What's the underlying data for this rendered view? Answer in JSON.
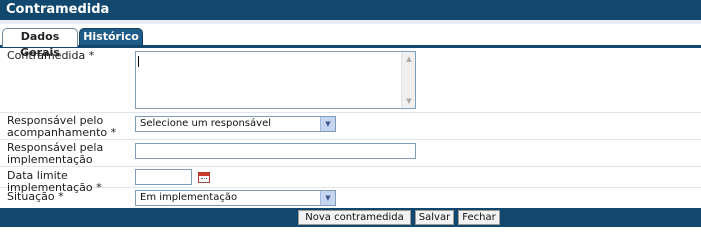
{
  "window": {
    "title": "Contramedida"
  },
  "tabs": [
    {
      "label": "Dados Gerais",
      "active": true
    },
    {
      "label": "Histórico",
      "active": false
    }
  ],
  "form": {
    "contramedida": {
      "label": "Contramedida *",
      "value": ""
    },
    "responsavel_acompanhamento": {
      "label_line1": "Responsável pelo",
      "label_line2": "acompanhamento *",
      "selected": "Selecione um responsável"
    },
    "responsavel_implementacao": {
      "label_line1": "Responsável pela",
      "label_line2": "implementação",
      "value": ""
    },
    "data_limite": {
      "label": "Data limite implementação *",
      "value": "",
      "icon": "calendar-icon"
    },
    "situacao": {
      "label": "Situação *",
      "selected": "Em implementação"
    }
  },
  "buttons": {
    "nova": "Nova contramedida",
    "salvar": "Salvar",
    "fechar": "Fechar"
  },
  "colors": {
    "header": "#12486e",
    "tab_inactive": "#1e5b86",
    "field_border": "#7f9db9"
  }
}
